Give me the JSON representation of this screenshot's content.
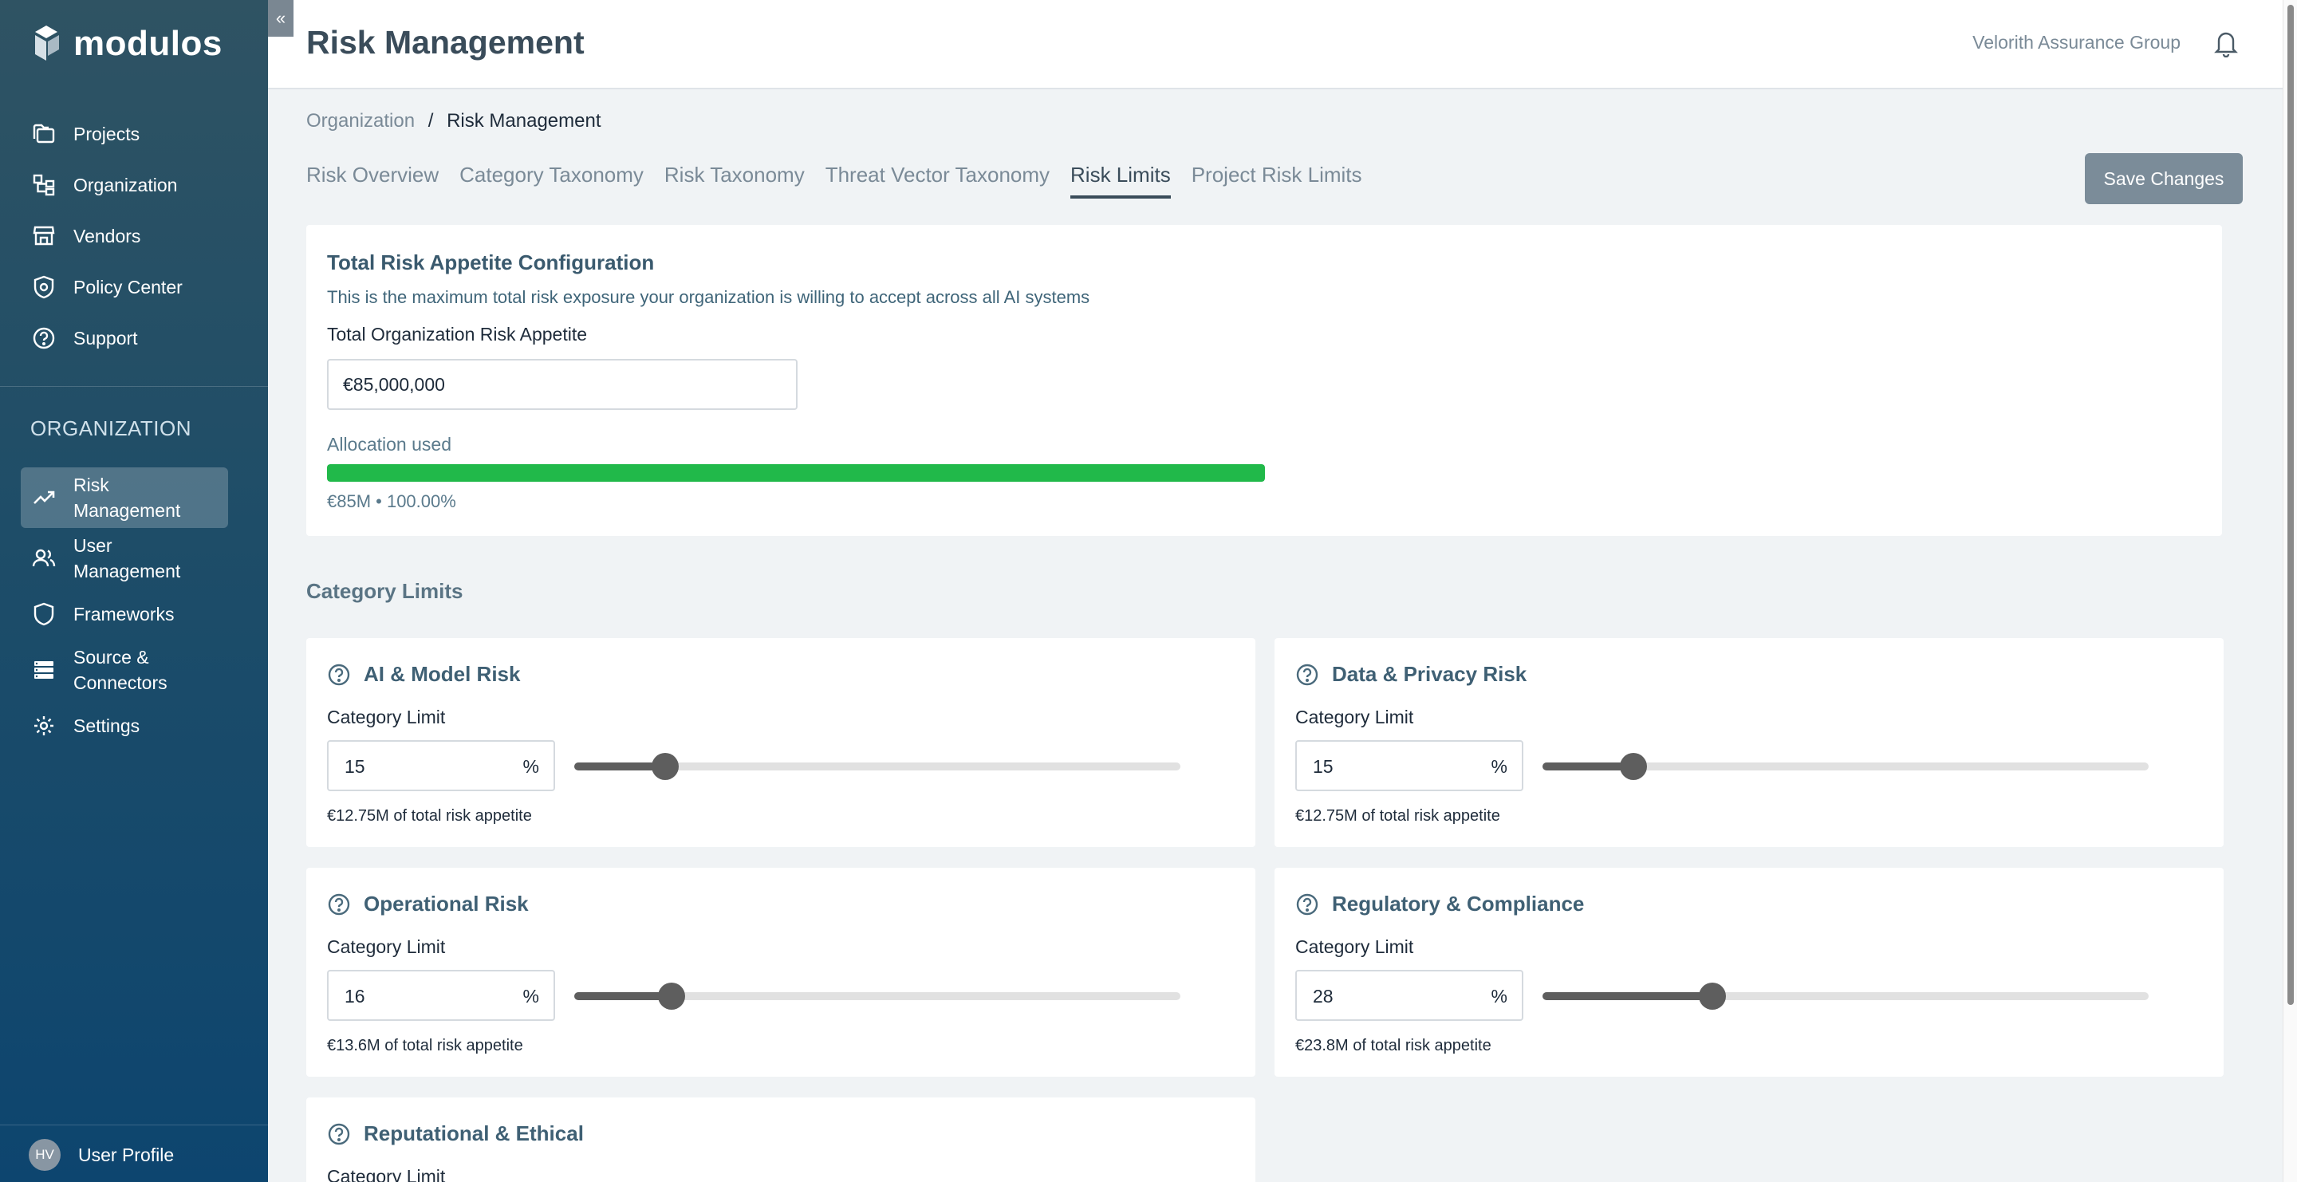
{
  "app": {
    "logo_text": "modulos"
  },
  "sidebar": {
    "items": [
      {
        "label": "Projects",
        "icon": "folder-icon"
      },
      {
        "label": "Organization",
        "icon": "org-chart-icon"
      },
      {
        "label": "Vendors",
        "icon": "store-icon"
      },
      {
        "label": "Policy Center",
        "icon": "shield-gear-icon"
      },
      {
        "label": "Support",
        "icon": "help-circle-icon"
      }
    ],
    "section_label": "ORGANIZATION",
    "org_items": [
      {
        "label": "Risk\nManagement",
        "icon": "trending-up-icon",
        "active": true
      },
      {
        "label": "User\nManagement",
        "icon": "users-icon"
      },
      {
        "label": "Frameworks",
        "icon": "shield-icon"
      },
      {
        "label": "Source &\nConnectors",
        "icon": "list-icon"
      },
      {
        "label": "Settings",
        "icon": "gear-icon"
      }
    ],
    "profile": {
      "initials": "HV",
      "label": "User Profile"
    }
  },
  "header": {
    "title": "Risk Management",
    "org_name": "Velorith Assurance Group"
  },
  "breadcrumb": {
    "parent": "Organization",
    "separator": "/",
    "current": "Risk Management"
  },
  "tabs": [
    {
      "label": "Risk Overview"
    },
    {
      "label": "Category Taxonomy"
    },
    {
      "label": "Risk Taxonomy"
    },
    {
      "label": "Threat Vector Taxonomy"
    },
    {
      "label": "Risk Limits",
      "active": true
    },
    {
      "label": "Project Risk Limits"
    }
  ],
  "save_label": "Save Changes",
  "appetite": {
    "title": "Total Risk Appetite Configuration",
    "description": "This is the maximum total risk exposure your organization is willing to accept across all AI systems",
    "field_label": "Total Organization Risk Appetite",
    "value": "€85,000,000",
    "allocation_label": "Allocation used",
    "allocation_fraction": 1.0,
    "allocation_text": "€85M • 100.00%",
    "bar_color": "#21b94a"
  },
  "category_section_title": "Category Limits",
  "categories": [
    {
      "title": "AI & Model Risk",
      "limit_label": "Category Limit",
      "value": "15",
      "unit": "%",
      "note": "€12.75M of total risk appetite"
    },
    {
      "title": "Data & Privacy Risk",
      "limit_label": "Category Limit",
      "value": "15",
      "unit": "%",
      "note": "€12.75M of total risk appetite"
    },
    {
      "title": "Operational Risk",
      "limit_label": "Category Limit",
      "value": "16",
      "unit": "%",
      "note": "€13.6M of total risk appetite"
    },
    {
      "title": "Regulatory & Compliance",
      "limit_label": "Category Limit",
      "value": "28",
      "unit": "%",
      "note": "€23.8M of total risk appetite"
    },
    {
      "title": "Reputational & Ethical",
      "limit_label": "Category Limit"
    }
  ]
}
